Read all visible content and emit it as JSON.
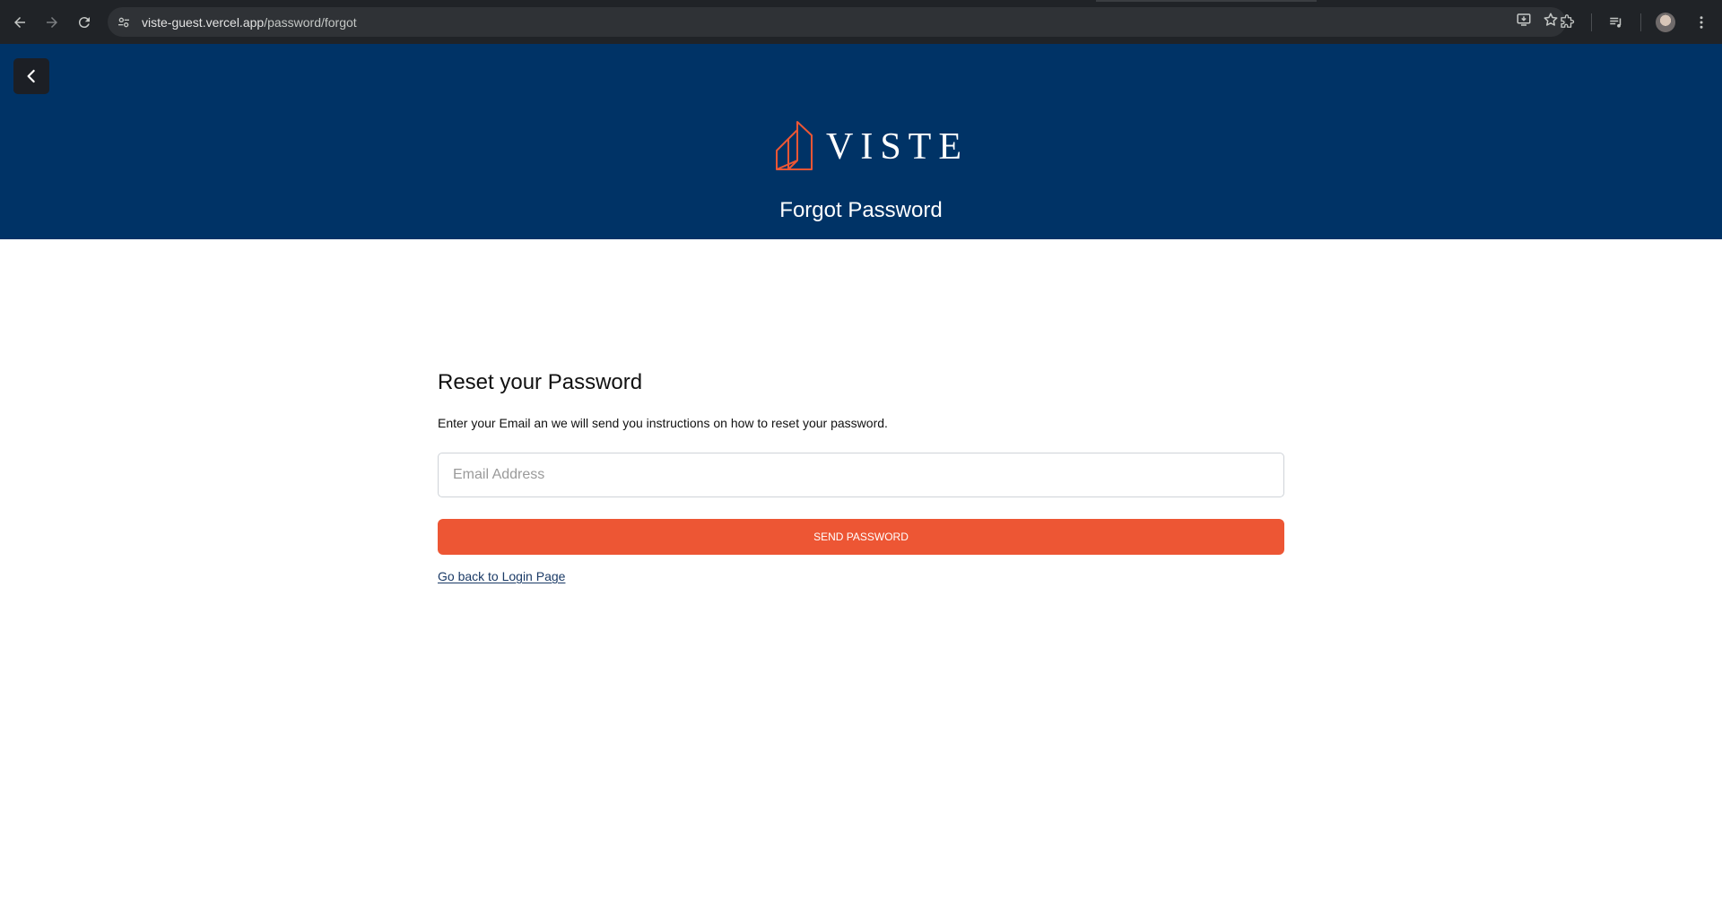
{
  "browser": {
    "url_host": "viste-guest.vercel.app",
    "url_path": "/password/forgot"
  },
  "header": {
    "brand_name": "VISTE",
    "page_title": "Forgot Password"
  },
  "form": {
    "heading": "Reset your Password",
    "instructions": "Enter your Email an we will send you instructions on how to reset your password.",
    "email_placeholder": "Email Address",
    "email_value": "",
    "submit_label": "SEND PASSWORD",
    "back_link": "Go back to Login Page"
  },
  "colors": {
    "header_bg": "#003366",
    "accent": "#ed5634",
    "browser_chrome": "#202327"
  },
  "icons": {
    "browser_back": "arrow-left-icon",
    "browser_forward": "arrow-right-icon",
    "browser_reload": "reload-icon",
    "site_info": "tune-icon",
    "install": "install-app-icon",
    "bookmark": "star-icon",
    "extensions": "puzzle-icon",
    "media": "media-controls-icon",
    "menu": "kebab-menu-icon",
    "page_back": "chevron-left-icon"
  }
}
